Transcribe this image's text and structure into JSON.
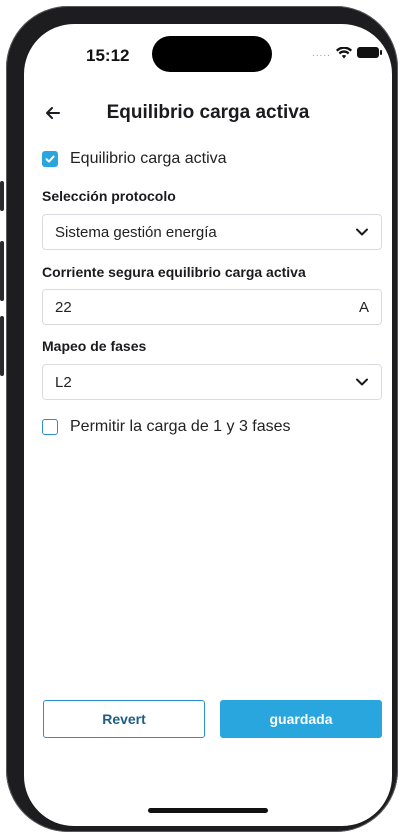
{
  "status_bar": {
    "time": "15:12",
    "dots": "....."
  },
  "header": {
    "title": "Equilibrio carga activa"
  },
  "active_balance": {
    "label": "Equilibrio carga activa",
    "checked": true
  },
  "protocol": {
    "label": "Selección protocolo",
    "selected": "Sistema gestión energía"
  },
  "safe_current": {
    "label": "Corriente segura equilibrio carga activa",
    "value": "22",
    "unit": "A"
  },
  "phase_mapping": {
    "label": "Mapeo de fases",
    "selected": "L2"
  },
  "phase_switch": {
    "label": "Permitir la carga de 1 y 3 fases",
    "checked": false
  },
  "actions": {
    "revert_label": "Revert",
    "save_label": "guardada"
  },
  "colors": {
    "accent": "#2aa6de",
    "outline": "#2a8fcf",
    "text": "#1b1b1f"
  }
}
